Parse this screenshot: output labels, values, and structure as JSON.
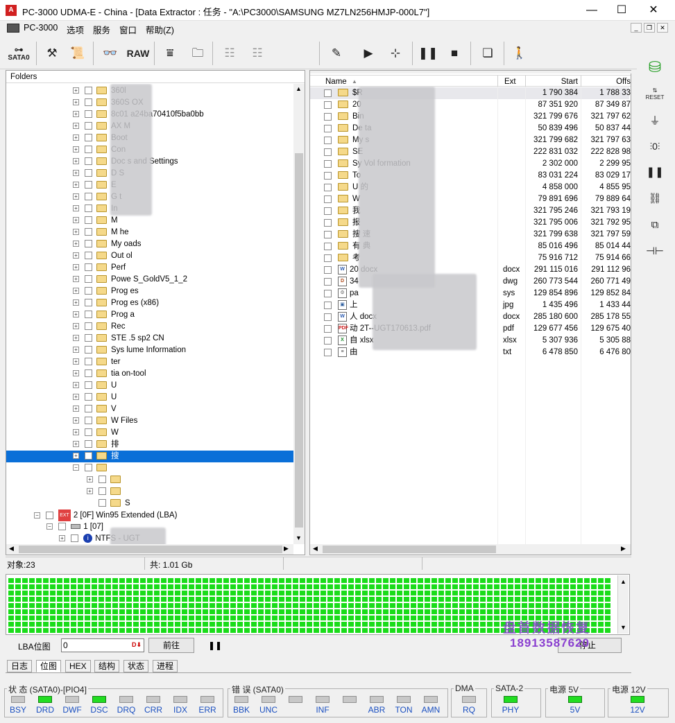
{
  "titlebar": {
    "title": "PC-3000 UDMA-E - China - [Data Extractor : 任务 - \"A:\\PC3000\\SAMSUNG MZ7LN256HMJP-000L7\"]",
    "minimize": "—",
    "maximize": "☐",
    "close": "✕"
  },
  "menubar": {
    "items": [
      "PC-3000",
      "选项",
      "服务",
      "窗口",
      "帮助(Z)"
    ]
  },
  "toolbar": {
    "sata_label": "SATA0",
    "raw_label": "RAW"
  },
  "folders_panel": {
    "header": "Folders",
    "rows": [
      {
        "label": "360l"
      },
      {
        "label": "360S    OX"
      },
      {
        "label": "8c01      a24ba70410f5ba0bb"
      },
      {
        "label": "AX M"
      },
      {
        "label": "Boot"
      },
      {
        "label": "Con"
      },
      {
        "label": "Doc      s and Settings"
      },
      {
        "label": "D       S"
      },
      {
        "label": "E"
      },
      {
        "label": "G        t"
      },
      {
        "label": "In"
      },
      {
        "label": "M"
      },
      {
        "label": "M        he"
      },
      {
        "label": "My       oads"
      },
      {
        "label": "Out      ol"
      },
      {
        "label": "Perf"
      },
      {
        "label": "Powe      S_GoldV5_1_2"
      },
      {
        "label": "Prog      es"
      },
      {
        "label": "Prog      es (x86)"
      },
      {
        "label": "Prog      a"
      },
      {
        "label": "Rec"
      },
      {
        "label": "STE      .5 sp2 CN"
      },
      {
        "label": "Sys      lume Information"
      },
      {
        "label": "ter"
      },
      {
        "label": "tia        on-tool"
      },
      {
        "label": "U"
      },
      {
        "label": "U"
      },
      {
        "label": "V"
      },
      {
        "label": "W       Files"
      },
      {
        "label": "W"
      },
      {
        "label": "排"
      },
      {
        "label": "搜"
      },
      {
        "label": ""
      },
      {
        "label": ""
      },
      {
        "label": ""
      },
      {
        "label": "S"
      }
    ],
    "partition_label": "2 [0F] Win95 Extended  (LBA)",
    "partition_tag": "EXT",
    "sub_label": "1 [07]",
    "ntfs_label": "NTFS - UGT"
  },
  "files_panel": {
    "columns": {
      "name": "Name",
      "ext": "Ext",
      "start": "Start",
      "offset": "Offs"
    },
    "rows": [
      {
        "name": "$R",
        "ext": "",
        "start": "1 790 384",
        "offset": "1 788 33",
        "icon": "folder"
      },
      {
        "name": "20",
        "ext": "",
        "start": "87 351 920",
        "offset": "87 349 87",
        "icon": "folder"
      },
      {
        "name": "Bin",
        "ext": "",
        "start": "321 799 676",
        "offset": "321 797 62",
        "icon": "folder"
      },
      {
        "name": "De        ta",
        "ext": "",
        "start": "50 839 496",
        "offset": "50 837 44",
        "icon": "folder"
      },
      {
        "name": "My       s",
        "ext": "",
        "start": "321 799 682",
        "offset": "321 797 63",
        "icon": "folder"
      },
      {
        "name": "SE",
        "ext": "",
        "start": "222 831 032",
        "offset": "222 828 98",
        "icon": "folder"
      },
      {
        "name": "Sy       Vol      formation",
        "ext": "",
        "start": "2 302 000",
        "offset": "2 299 95",
        "icon": "folder"
      },
      {
        "name": "To",
        "ext": "",
        "start": "83 031 224",
        "offset": "83 029 17",
        "icon": "folder"
      },
      {
        "name": "U       的",
        "ext": "",
        "start": "4 858 000",
        "offset": "4 855 95",
        "icon": "folder"
      },
      {
        "name": "W",
        "ext": "",
        "start": "79 891 696",
        "offset": "79 889 64",
        "icon": "folder"
      },
      {
        "name": "我",
        "ext": "",
        "start": "321 795 246",
        "offset": "321 793 19",
        "icon": "folder"
      },
      {
        "name": "报",
        "ext": "",
        "start": "321 795 006",
        "offset": "321 792 95",
        "icon": "folder"
      },
      {
        "name": "搜      速",
        "ext": "",
        "start": "321 799 638",
        "offset": "321 797 59",
        "icon": "folder"
      },
      {
        "name": "有      典",
        "ext": "",
        "start": "85 016 496",
        "offset": "85 014 44",
        "icon": "folder"
      },
      {
        "name": "考",
        "ext": "",
        "start": "75 916 712",
        "offset": "75 914 66",
        "icon": "folder"
      },
      {
        "name": "20                   docx",
        "ext": "docx",
        "start": "291 115 016",
        "offset": "291 112 96",
        "icon": "word"
      },
      {
        "name": "34",
        "ext": "dwg",
        "start": "260 773 544",
        "offset": "260 771 49",
        "icon": "dwg"
      },
      {
        "name": "pa",
        "ext": "sys",
        "start": "129 854 896",
        "offset": "129 852 84",
        "icon": "sys"
      },
      {
        "name": "上",
        "ext": "jpg",
        "start": "1 435 496",
        "offset": "1 433 44",
        "icon": "jpg"
      },
      {
        "name": "人              docx",
        "ext": "docx",
        "start": "285 180 600",
        "offset": "285 178 55",
        "icon": "word"
      },
      {
        "name": "动                  2T--UGT170613.pdf",
        "ext": "pdf",
        "start": "129 677 456",
        "offset": "129 675 40",
        "icon": "pdf"
      },
      {
        "name": "自                   xlsx",
        "ext": "xlsx",
        "start": "5 307 936",
        "offset": "5 305 88",
        "icon": "excel"
      },
      {
        "name": "由",
        "ext": "txt",
        "start": "6 478 850",
        "offset": "6 476 80",
        "icon": "txt"
      }
    ]
  },
  "statusbar": {
    "objects": "对象:23",
    "total": "共: 1.01 Gb"
  },
  "lba": {
    "label": "LBA位图",
    "value": "0",
    "goto_button": "前往",
    "stop_button": "停止"
  },
  "tabs": [
    "日志",
    "位图",
    "HEX",
    "结构",
    "状态",
    "进程"
  ],
  "active_tab": "位图",
  "indicators": {
    "status_group": "状 态 (SATA0)-[PIO4]",
    "status_leds": [
      {
        "label": "BSY",
        "on": false
      },
      {
        "label": "DRD",
        "on": true
      },
      {
        "label": "DWF",
        "on": false
      },
      {
        "label": "DSC",
        "on": true
      },
      {
        "label": "DRQ",
        "on": false
      },
      {
        "label": "CRR",
        "on": false
      },
      {
        "label": "IDX",
        "on": false
      },
      {
        "label": "ERR",
        "on": false
      }
    ],
    "error_group": "错 误 (SATA0)",
    "error_leds": [
      {
        "label": "BBK",
        "on": false
      },
      {
        "label": "UNC",
        "on": false
      },
      {
        "label": "",
        "on": false
      },
      {
        "label": "INF",
        "on": false
      },
      {
        "label": "",
        "on": false
      },
      {
        "label": "ABR",
        "on": false
      },
      {
        "label": "TON",
        "on": false
      },
      {
        "label": "AMN",
        "on": false
      }
    ],
    "dma_group": "DMA",
    "dma_led": {
      "label": "RQ",
      "on": false
    },
    "sata_group": "SATA-2",
    "sata_led": {
      "label": "PHY",
      "on": true
    },
    "p5_group": "电源 5V",
    "p5_led": {
      "label": "5V",
      "on": true
    },
    "p12_group": "电源 12V",
    "p12_led": {
      "label": "12V",
      "on": true
    }
  },
  "watermark": {
    "line1": "盘首数据恢复",
    "line2": "18913587620"
  },
  "colors": {
    "led_on": "#22dd22",
    "selection": "#0a6fd8",
    "bitmap": "#1adc1a",
    "watermark": "#8a3fd0"
  }
}
